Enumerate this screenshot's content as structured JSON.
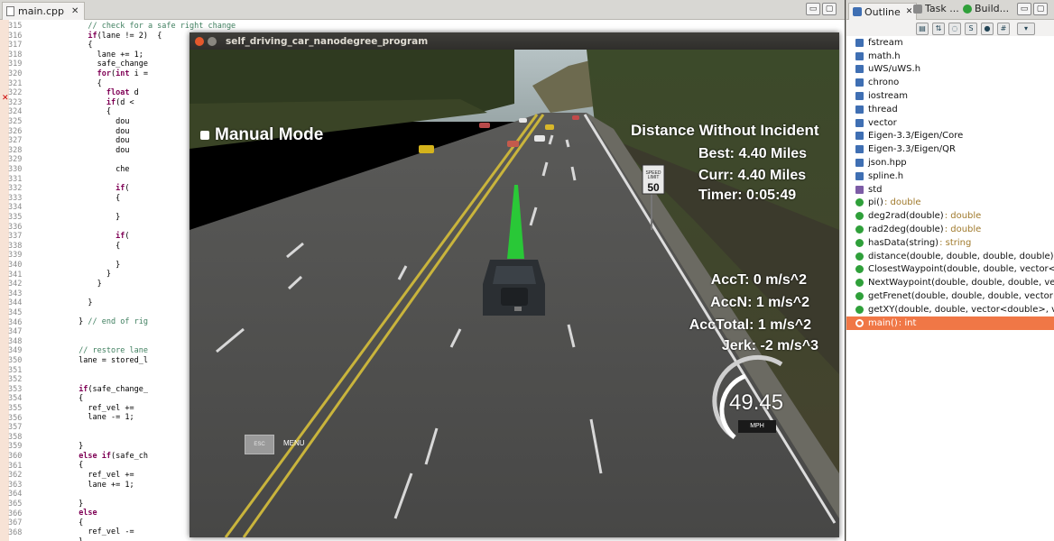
{
  "editor": {
    "tab_label": "main.cpp",
    "line_numbers": [
      "315",
      "316",
      "317",
      "318",
      "319",
      "320",
      "321",
      "322",
      "323",
      "324",
      "325",
      "326",
      "327",
      "328",
      "329",
      "330",
      "331",
      "332",
      "333",
      "334",
      "335",
      "336",
      "337",
      "338",
      "339",
      "340",
      "341",
      "342",
      "343",
      "344",
      "345",
      "346",
      "347",
      "348",
      "349",
      "350",
      "351",
      "352",
      "353",
      "354",
      "355",
      "356",
      "357",
      "358",
      "359",
      "360",
      "361",
      "362",
      "363",
      "364",
      "365",
      "366",
      "367",
      "368"
    ],
    "code_lines": [
      "            // check for a safe right change",
      "            if(lane != 2)  {",
      "            {",
      "              lane += 1;",
      "              safe_change",
      "              for(int i =",
      "              {",
      "                float d",
      "                if(d <",
      "                {",
      "                  dou",
      "                  dou",
      "                  dou",
      "                  dou",
      "",
      "                  che",
      "",
      "                  if(",
      "                  {",
      "",
      "                  }",
      "",
      "                  if(",
      "                  {",
      "",
      "                  }",
      "                }",
      "              }",
      "",
      "            }",
      "",
      "          } // end of rig",
      "",
      "",
      "          // restore lane",
      "          lane = stored_l",
      "",
      "",
      "          if(safe_change_",
      "          {",
      "            ref_vel +=",
      "            lane -= 1;",
      "",
      "",
      "          }",
      "          else if(safe_ch",
      "          {",
      "            ref_vel +=",
      "            lane += 1;",
      "",
      "          }",
      "          else",
      "          {",
      "            ref_vel -=",
      "          }"
    ]
  },
  "outline": {
    "tabs": [
      {
        "label": "Outline"
      },
      {
        "label": "Task ..."
      },
      {
        "label": "Build..."
      }
    ],
    "items": [
      {
        "kind": "inc",
        "label": "fstream",
        "type": ""
      },
      {
        "kind": "inc",
        "label": "math.h",
        "type": ""
      },
      {
        "kind": "inc",
        "label": "uWS/uWS.h",
        "type": ""
      },
      {
        "kind": "inc",
        "label": "chrono",
        "type": ""
      },
      {
        "kind": "inc",
        "label": "iostream",
        "type": ""
      },
      {
        "kind": "inc",
        "label": "thread",
        "type": ""
      },
      {
        "kind": "inc",
        "label": "vector",
        "type": ""
      },
      {
        "kind": "inc",
        "label": "Eigen-3.3/Eigen/Core",
        "type": ""
      },
      {
        "kind": "inc",
        "label": "Eigen-3.3/Eigen/QR",
        "type": ""
      },
      {
        "kind": "inc",
        "label": "json.hpp",
        "type": ""
      },
      {
        "kind": "inc",
        "label": "spline.h",
        "type": ""
      },
      {
        "kind": "ns",
        "label": "std",
        "type": ""
      },
      {
        "kind": "fn",
        "label": "pi()",
        "type": " : double"
      },
      {
        "kind": "fn",
        "label": "deg2rad(double)",
        "type": " : double"
      },
      {
        "kind": "fn",
        "label": "rad2deg(double)",
        "type": " : double"
      },
      {
        "kind": "fn",
        "label": "hasData(string)",
        "type": " : string"
      },
      {
        "kind": "fn",
        "label": "distance(double, double, double, double) :",
        "type": ""
      },
      {
        "kind": "fn",
        "label": "ClosestWaypoint(double, double, vector<do",
        "type": ""
      },
      {
        "kind": "fn",
        "label": "NextWaypoint(double, double, double, vec",
        "type": ""
      },
      {
        "kind": "fn",
        "label": "getFrenet(double, double, double, vector<",
        "type": ""
      },
      {
        "kind": "fn",
        "label": "getXY(double, double, vector<double>, vec",
        "type": ""
      },
      {
        "kind": "fn",
        "label": "main()",
        "type": " : int",
        "selected": true
      }
    ]
  },
  "simulator": {
    "window_title": "self_driving_car_nanodegree_program",
    "manual_mode_label": "Manual Mode",
    "distance_title": "Distance Without Incident",
    "best": "Best: 4.40 Miles",
    "curr": "Curr: 4.40 Miles",
    "timer": "Timer: 0:05:49",
    "acc_t": "AccT: 0 m/s^2",
    "acc_n": "AccN: 1 m/s^2",
    "acc_total": "AccTotal: 1 m/s^2",
    "jerk": "Jerk: -2 m/s^3",
    "speed": "49.45",
    "speed_unit": "MPH",
    "speed_limit_top": "SPEED LIMIT",
    "speed_limit_value": "50",
    "esc_label": "ESC",
    "menu_label": "MENU"
  },
  "colors": {
    "selection": "#f07746",
    "keyword": "#7f0055",
    "comment": "#3f7f5f",
    "path_green": "#22dd33",
    "road_yellow": "#c9b43c"
  }
}
